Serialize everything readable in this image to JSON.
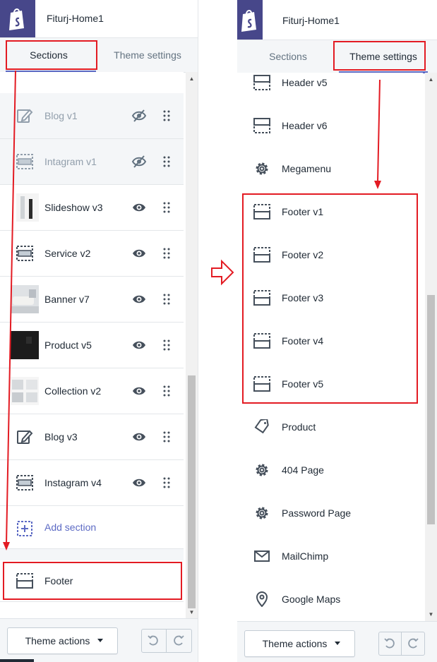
{
  "left": {
    "store_name": "Fiturj-Home1",
    "tabs": [
      "Sections",
      "Theme settings"
    ],
    "sections": [
      {
        "label": "Blog v1",
        "icon": "blog-icon",
        "visibility": "hidden"
      },
      {
        "label": "Intagram v1",
        "icon": "section-layout-icon",
        "visibility": "hidden"
      },
      {
        "label": "Slideshow v3",
        "icon": "slideshow-thumbnail",
        "visibility": "visible"
      },
      {
        "label": "Service v2",
        "icon": "section-layout-icon",
        "visibility": "visible"
      },
      {
        "label": "Banner v7",
        "icon": "banner-thumbnail",
        "visibility": "visible"
      },
      {
        "label": "Product v5",
        "icon": "product-thumbnail",
        "visibility": "visible"
      },
      {
        "label": "Collection v2",
        "icon": "collection-thumbnail",
        "visibility": "visible"
      },
      {
        "label": "Blog v3",
        "icon": "blog-icon",
        "visibility": "visible"
      },
      {
        "label": "Instagram v4",
        "icon": "section-layout-icon",
        "visibility": "visible"
      }
    ],
    "add_section": "Add section",
    "footer": "Footer",
    "theme_actions": "Theme actions"
  },
  "right": {
    "store_name": "Fiturj-Home1",
    "tabs": [
      "Sections",
      "Theme settings"
    ],
    "items": [
      {
        "label": "Header v5",
        "icon": "section-layout-icon"
      },
      {
        "label": "Header v6",
        "icon": "section-layout-icon"
      },
      {
        "label": "Megamenu",
        "icon": "gear-icon"
      },
      {
        "label": "Footer v1",
        "icon": "footer-layout-icon"
      },
      {
        "label": "Footer v2",
        "icon": "footer-layout-icon"
      },
      {
        "label": "Footer v3",
        "icon": "footer-layout-icon"
      },
      {
        "label": "Footer v4",
        "icon": "footer-layout-icon"
      },
      {
        "label": "Footer v5",
        "icon": "footer-layout-icon"
      },
      {
        "label": "Product",
        "icon": "tag-icon"
      },
      {
        "label": "404 Page",
        "icon": "gear-icon"
      },
      {
        "label": "Password Page",
        "icon": "gear-icon"
      },
      {
        "label": "MailChimp",
        "icon": "mail-icon"
      },
      {
        "label": "Google Maps",
        "icon": "map-pin-icon"
      }
    ],
    "theme_actions": "Theme actions"
  },
  "colors": {
    "accent": "#5c6ac4",
    "highlight": "#e31b23",
    "logo_bg": "#47478a"
  }
}
